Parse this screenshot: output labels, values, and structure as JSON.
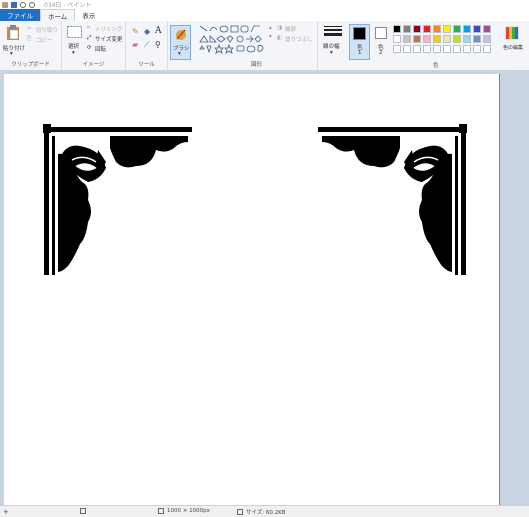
{
  "titlebar": {
    "title": "034日 - ペイント"
  },
  "tabs": [
    {
      "label": "ファイル"
    },
    {
      "label": "ホーム"
    },
    {
      "label": "表示"
    }
  ],
  "ribbon": {
    "clipboard": {
      "paste_label": "貼り付け",
      "cut_label": "切り取り",
      "copy_label": "コピー",
      "group_label": "クリップボード"
    },
    "image": {
      "select_label": "選択",
      "crop_label": "トリミング",
      "resize_label": "サイズ変更",
      "rotate_label": "回転",
      "group_label": "イメージ"
    },
    "tools": {
      "group_label": "ツール"
    },
    "brush": {
      "label": "ブラシ"
    },
    "shapes": {
      "outline_label": "輪郭",
      "fill_label": "塗りつぶし",
      "group_label": "図形"
    },
    "size": {
      "label": "線の幅"
    },
    "color1": {
      "label": "色",
      "number": "1"
    },
    "color2": {
      "label": "色",
      "number": "2"
    },
    "colors": {
      "group_label": "色",
      "edit_label": "色の編集",
      "swatches": [
        "#000000",
        "#7f7f7f",
        "#880015",
        "#ed1c24",
        "#ff7f27",
        "#fff200",
        "#22b14c",
        "#00a2e8",
        "#3f48cc",
        "#a349a4",
        "#ffffff",
        "#c3c3c3",
        "#b97a57",
        "#ffaec9",
        "#ffc90e",
        "#efe4b0",
        "#b5e61d",
        "#99d9ea",
        "#7092be",
        "#c8bfe7",
        "#ffffff",
        "#ffffff",
        "#ffffff",
        "#ffffff",
        "#ffffff",
        "#ffffff",
        "#ffffff",
        "#ffffff",
        "#ffffff",
        "#ffffff"
      ]
    }
  },
  "statusbar": {
    "dimensions": "1000 × 1000px",
    "size": "サイズ: 60.2KB"
  }
}
